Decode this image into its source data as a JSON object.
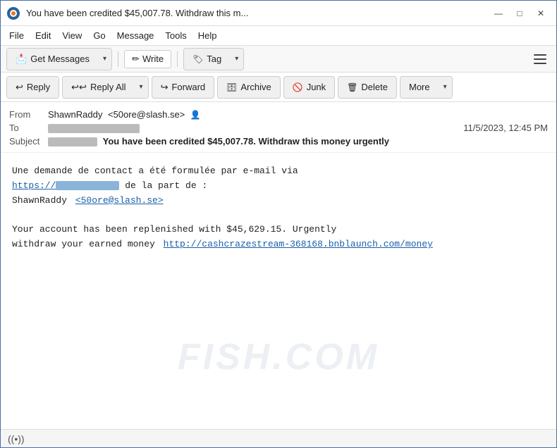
{
  "window": {
    "title": "You have been credited $45,007.78. Withdraw this m...",
    "icon": "thunderbird"
  },
  "window_controls": {
    "minimize": "—",
    "maximize": "□",
    "close": "✕"
  },
  "menu": {
    "items": [
      "File",
      "Edit",
      "View",
      "Go",
      "Message",
      "Tools",
      "Help"
    ]
  },
  "toolbar": {
    "get_messages": "Get Messages",
    "write": "Write",
    "tag": "Tag"
  },
  "actions": {
    "reply": "Reply",
    "reply_all": "Reply All",
    "forward": "Forward",
    "archive": "Archive",
    "junk": "Junk",
    "delete": "Delete",
    "more": "More"
  },
  "email": {
    "from_label": "From",
    "from_name": "ShawnRaddy",
    "from_email": "<50ore@slash.se>",
    "to_label": "To",
    "to_value": "██████████████",
    "date": "11/5/2023, 12:45 PM",
    "subject_label": "Subject",
    "subject_prefix": "███████",
    "subject_bold": "You have been credited $45,007.78. Withdraw this money urgently"
  },
  "body": {
    "line1": "Une demande de contact a été formulée par e-mail via",
    "link1": "https://",
    "link1_blur": "████████████",
    "line2": " de la part de :",
    "sender_name": "ShawnRaddy",
    "sender_email": "<50ore@slash.se>",
    "blank": "",
    "paragraph2_line1": "Your account has been replenished with $45,629.15. Urgently",
    "paragraph2_line2": "withdraw your earned money",
    "link2": "http://cashcrazestream-368168.bnblaunch.com/money"
  },
  "watermark": {
    "text": "FISH.COM"
  },
  "status": {
    "icon": "((•))"
  }
}
